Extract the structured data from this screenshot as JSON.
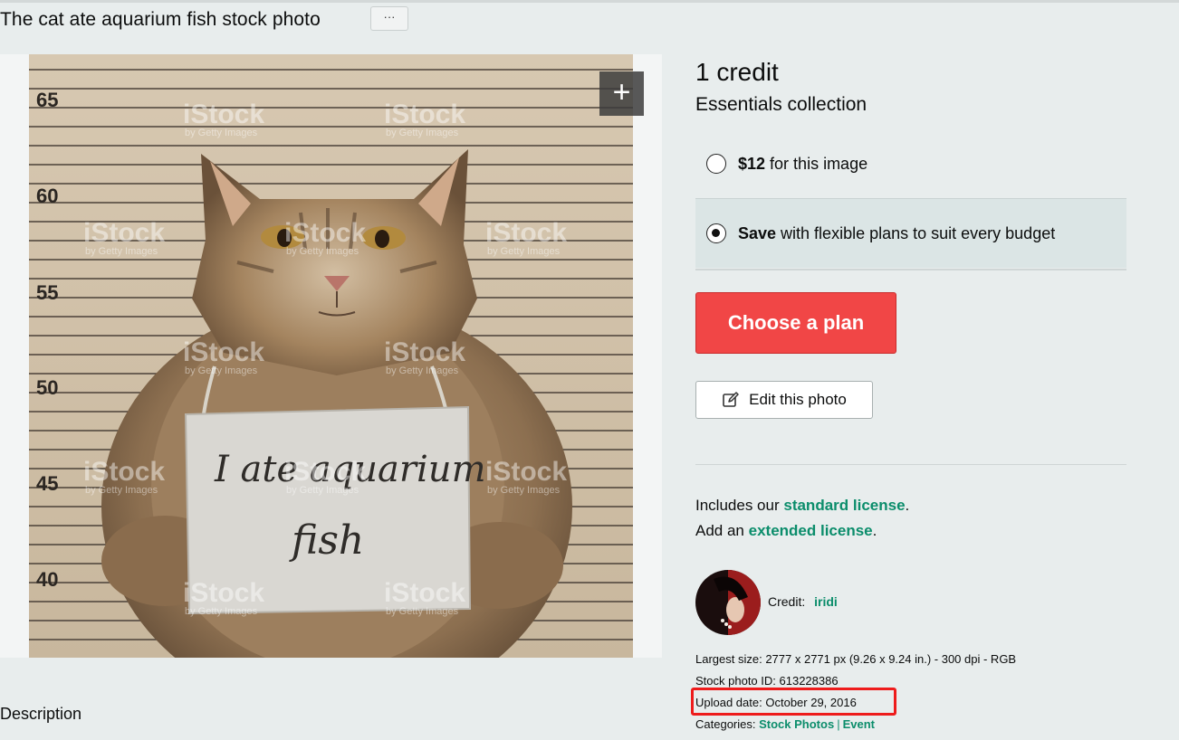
{
  "page": {
    "title": "The cat ate aquarium fish stock photo",
    "more_label": "···",
    "zoom_label": "+"
  },
  "photo": {
    "sign_line1": "I ate aquarium",
    "sign_line2": "fish",
    "height_marks": [
      "65",
      "60",
      "55",
      "50",
      "45",
      "40"
    ],
    "watermark": "iStock",
    "watermark_sub": "by Getty Images"
  },
  "purchase": {
    "credit": "1 credit",
    "collection": "Essentials collection",
    "option1_price": "$12",
    "option1_text": "for this image",
    "option2_bold": "Save",
    "option2_text": "with flexible plans to suit every budget",
    "selected_option": 2,
    "choose_label": "Choose a plan",
    "edit_label": "Edit this photo"
  },
  "license": {
    "line1_prefix": "Includes our",
    "line1_link": "standard license",
    "line1_suffix": ".",
    "line2_prefix": "Add an",
    "line2_link": "extended license",
    "line2_suffix": "."
  },
  "contributor": {
    "credit_label": "Credit:",
    "name": "iridi"
  },
  "details": {
    "largest_size_label": "Largest size:",
    "largest_size_value": "2777 x 2771 px (9.26 x 9.24 in.) - 300 dpi - RGB",
    "stock_id_label": "Stock photo ID:",
    "stock_id_value": "613228386",
    "upload_label": "Upload date:",
    "upload_value": "October 29, 2016",
    "categories_label": "Categories:",
    "categories": [
      "Stock Photos",
      "Event"
    ],
    "category_separator": "|"
  },
  "description": {
    "heading": "Description"
  },
  "colors": {
    "accent_link": "#0b8d6b",
    "primary_button": "#f14646",
    "highlight_box": "#ee1c1c",
    "selected_option_bg": "#dbe5e5"
  }
}
